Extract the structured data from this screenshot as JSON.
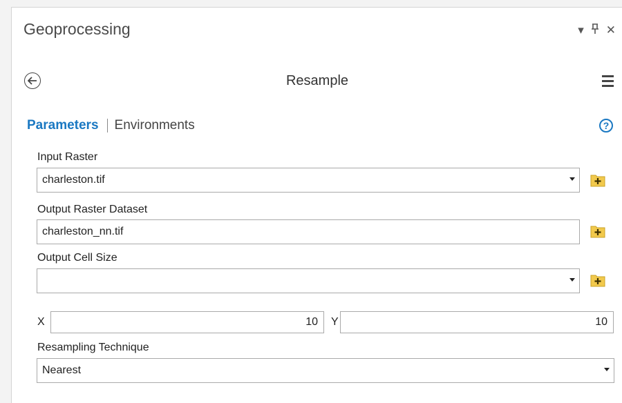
{
  "pane": {
    "title": "Geoprocessing"
  },
  "pane_controls": {
    "menu_glyph": "▾",
    "pin_glyph": "Ⴔ",
    "close_glyph": "✕"
  },
  "tool": {
    "title": "Resample"
  },
  "tabs": [
    {
      "label": "Parameters",
      "active": true
    },
    {
      "label": "Environments",
      "active": false
    }
  ],
  "help": {
    "glyph": "?"
  },
  "params": {
    "input_raster": {
      "label": "Input Raster",
      "value": "charleston.tif"
    },
    "output_raster": {
      "label": "Output Raster Dataset",
      "value": "charleston_nn.tif"
    },
    "cell_size": {
      "label": "Output Cell Size",
      "value": ""
    },
    "x": {
      "label": "X",
      "value": "10"
    },
    "y": {
      "label": "Y",
      "value": "10"
    },
    "technique": {
      "label": "Resampling Technique",
      "value": "Nearest"
    }
  },
  "icons": {
    "back": "arrow-left-circle-icon",
    "menu": "hamburger-menu-icon",
    "help": "question-circle-icon",
    "browse": "folder-add-icon"
  },
  "colors": {
    "accent": "#1a78c2",
    "folder": "#f2c94c"
  }
}
